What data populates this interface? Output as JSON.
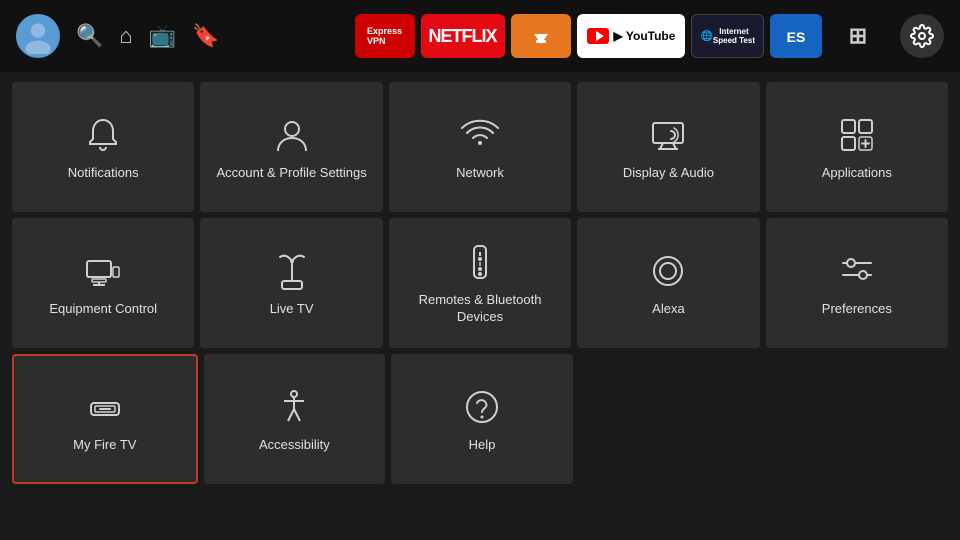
{
  "topbar": {
    "avatar_initial": "👤",
    "nav_icons": [
      "search",
      "home",
      "tv",
      "bookmark"
    ],
    "apps": [
      {
        "id": "expressvpn",
        "label": "Express\nVPN",
        "style": "expressvpn"
      },
      {
        "id": "netflix",
        "label": "NETFLIX",
        "style": "netflix"
      },
      {
        "id": "downloader",
        "label": "⬇",
        "style": "downloader"
      },
      {
        "id": "youtube",
        "label": "▶ YouTube",
        "style": "youtube"
      },
      {
        "id": "speedtest",
        "label": "Internet\nSpeed Test",
        "style": "speedtest"
      },
      {
        "id": "es",
        "label": "ES",
        "style": "es"
      },
      {
        "id": "add",
        "label": "⊞+",
        "style": "add"
      }
    ],
    "settings_icon": "⚙"
  },
  "grid": {
    "rows": [
      [
        {
          "id": "notifications",
          "label": "Notifications",
          "icon": "bell"
        },
        {
          "id": "account",
          "label": "Account & Profile Settings",
          "icon": "person"
        },
        {
          "id": "network",
          "label": "Network",
          "icon": "wifi"
        },
        {
          "id": "display-audio",
          "label": "Display & Audio",
          "icon": "display"
        },
        {
          "id": "applications",
          "label": "Applications",
          "icon": "apps"
        }
      ],
      [
        {
          "id": "equipment-control",
          "label": "Equipment Control",
          "icon": "monitor"
        },
        {
          "id": "live-tv",
          "label": "Live TV",
          "icon": "antenna"
        },
        {
          "id": "remotes-bluetooth",
          "label": "Remotes & Bluetooth Devices",
          "icon": "remote"
        },
        {
          "id": "alexa",
          "label": "Alexa",
          "icon": "alexa"
        },
        {
          "id": "preferences",
          "label": "Preferences",
          "icon": "sliders"
        }
      ],
      [
        {
          "id": "my-fire-tv",
          "label": "My Fire TV",
          "icon": "firetv",
          "focused": true
        },
        {
          "id": "accessibility",
          "label": "Accessibility",
          "icon": "accessibility"
        },
        {
          "id": "help",
          "label": "Help",
          "icon": "help"
        },
        {
          "id": "empty1",
          "label": "",
          "icon": ""
        },
        {
          "id": "empty2",
          "label": "",
          "icon": ""
        }
      ]
    ]
  }
}
